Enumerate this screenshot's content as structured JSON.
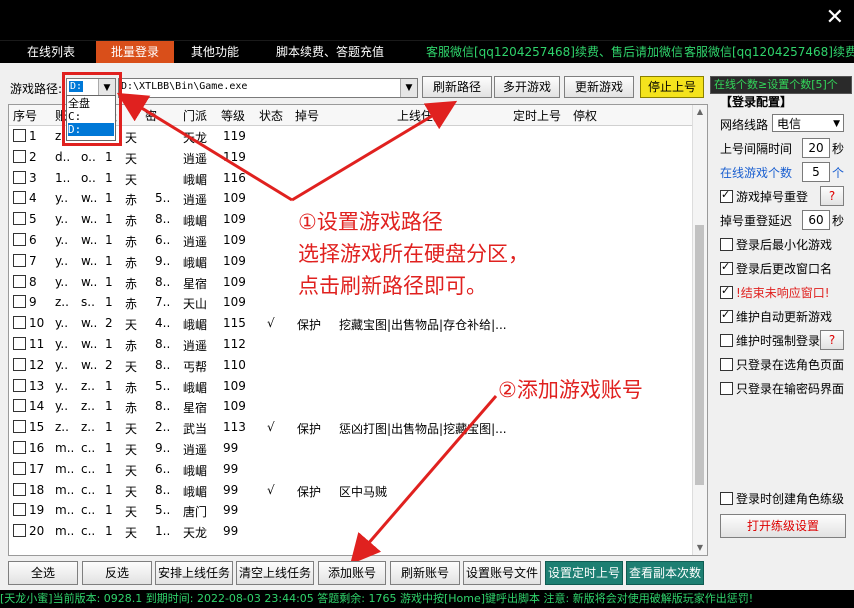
{
  "window": {
    "close_glyph": "✕"
  },
  "tabs": [
    {
      "label": "在线列表"
    },
    {
      "label": "批量登录"
    },
    {
      "label": "其他功能"
    },
    {
      "label": "脚本续费、答题充值"
    }
  ],
  "notices": [
    "客服微信[qq1204257468]续费、售后请加微信",
    "客服微信[qq1204257468]续费、售"
  ],
  "path": {
    "label": "游戏路径:",
    "drive_value": "D:",
    "exe_value": "D:\\XTLBB\\Bin\\Game.exe",
    "drive_options": [
      "全盘",
      "C:",
      "D:"
    ]
  },
  "toolbar": {
    "refresh_path": "刷新路径",
    "multi_open": "多开游戏",
    "update_game": "更新游戏",
    "stop_login": "停止上号"
  },
  "online_count_label": "在线个数≥设置个数[5]个",
  "grid": {
    "headers": [
      "序号",
      "账号",
      "服",
      "密",
      "门派",
      "等级",
      "状态",
      "掉号",
      "上线任务",
      "定时上号",
      "停权"
    ],
    "rows": [
      {
        "no": "1",
        "acc": "z..",
        "srv": "o..",
        "n": "1",
        "pw": "天",
        "pw2": "",
        "school": "天龙",
        "lvl": "119",
        "state": "",
        "drop": "",
        "task": ""
      },
      {
        "no": "2",
        "acc": "d..",
        "srv": "o..",
        "n": "1",
        "pw": "天",
        "pw2": "",
        "school": "逍遥",
        "lvl": "119",
        "state": "",
        "drop": "",
        "task": ""
      },
      {
        "no": "3",
        "acc": "1..",
        "srv": "o..",
        "n": "1",
        "pw": "天",
        "pw2": "",
        "school": "峨嵋",
        "lvl": "116",
        "state": "",
        "drop": "",
        "task": ""
      },
      {
        "no": "4",
        "acc": "y..",
        "srv": "w..",
        "n": "1",
        "pw": "赤",
        "pw2": "5..",
        "school": "逍遥",
        "lvl": "109",
        "state": "",
        "drop": "",
        "task": ""
      },
      {
        "no": "5",
        "acc": "y..",
        "srv": "w..",
        "n": "1",
        "pw": "赤",
        "pw2": "8..",
        "school": "峨嵋",
        "lvl": "109",
        "state": "",
        "drop": "",
        "task": ""
      },
      {
        "no": "6",
        "acc": "y..",
        "srv": "w..",
        "n": "1",
        "pw": "赤",
        "pw2": "6..",
        "school": "逍遥",
        "lvl": "109",
        "state": "",
        "drop": "",
        "task": ""
      },
      {
        "no": "7",
        "acc": "y..",
        "srv": "w..",
        "n": "1",
        "pw": "赤",
        "pw2": "9..",
        "school": "峨嵋",
        "lvl": "109",
        "state": "",
        "drop": "",
        "task": ""
      },
      {
        "no": "8",
        "acc": "y..",
        "srv": "w..",
        "n": "1",
        "pw": "赤",
        "pw2": "8..",
        "school": "星宿",
        "lvl": "109",
        "state": "",
        "drop": "",
        "task": ""
      },
      {
        "no": "9",
        "acc": "z..",
        "srv": "s..",
        "n": "1",
        "pw": "赤",
        "pw2": "7..",
        "school": "天山",
        "lvl": "109",
        "state": "",
        "drop": "",
        "task": ""
      },
      {
        "no": "10",
        "acc": "y..",
        "srv": "w..",
        "n": "2",
        "pw": "天",
        "pw2": "4..",
        "school": "峨嵋",
        "lvl": "115",
        "state": "√",
        "drop": "保护",
        "task": "挖藏宝图|出售物品|存仓补给|..."
      },
      {
        "no": "11",
        "acc": "y..",
        "srv": "w..",
        "n": "1",
        "pw": "赤",
        "pw2": "8..",
        "school": "逍遥",
        "lvl": "112",
        "state": "",
        "drop": "",
        "task": ""
      },
      {
        "no": "12",
        "acc": "y..",
        "srv": "w..",
        "n": "2",
        "pw": "天",
        "pw2": "8..",
        "school": "丐帮",
        "lvl": "110",
        "state": "",
        "drop": "",
        "task": ""
      },
      {
        "no": "13",
        "acc": "y..",
        "srv": "z..",
        "n": "1",
        "pw": "赤",
        "pw2": "5..",
        "school": "峨嵋",
        "lvl": "109",
        "state": "",
        "drop": "",
        "task": ""
      },
      {
        "no": "14",
        "acc": "y..",
        "srv": "z..",
        "n": "1",
        "pw": "赤",
        "pw2": "8..",
        "school": "星宿",
        "lvl": "109",
        "state": "",
        "drop": "",
        "task": ""
      },
      {
        "no": "15",
        "acc": "z..",
        "srv": "z..",
        "n": "1",
        "pw": "天",
        "pw2": "2..",
        "school": "武当",
        "lvl": "113",
        "state": "√",
        "drop": "保护",
        "task": "惩凶打图|出售物品|挖藏宝图|..."
      },
      {
        "no": "16",
        "acc": "m..",
        "srv": "c..",
        "n": "1",
        "pw": "天",
        "pw2": "9..",
        "school": "逍遥",
        "lvl": "99",
        "state": "",
        "drop": "",
        "task": ""
      },
      {
        "no": "17",
        "acc": "m..",
        "srv": "c..",
        "n": "1",
        "pw": "天",
        "pw2": "6..",
        "school": "峨嵋",
        "lvl": "99",
        "state": "",
        "drop": "",
        "task": ""
      },
      {
        "no": "18",
        "acc": "m..",
        "srv": "c..",
        "n": "1",
        "pw": "天",
        "pw2": "8..",
        "school": "峨嵋",
        "lvl": "99",
        "state": "√",
        "drop": "保护",
        "task": "区中马贼"
      },
      {
        "no": "19",
        "acc": "m..",
        "srv": "c..",
        "n": "1",
        "pw": "天",
        "pw2": "5..",
        "school": "唐门",
        "lvl": "99",
        "state": "",
        "drop": "",
        "task": ""
      },
      {
        "no": "20",
        "acc": "m..",
        "srv": "c..",
        "n": "1",
        "pw": "天",
        "pw2": "1..",
        "school": "天龙",
        "lvl": "99",
        "state": "",
        "drop": "",
        "task": ""
      }
    ]
  },
  "bottom_buttons": {
    "select_all": "全选",
    "invert": "反选",
    "arrange_tasks": "安排上线任务",
    "clear_tasks": "清空上线任务",
    "add_account": "添加账号",
    "refresh_account": "刷新账号",
    "set_account_file": "设置账号文件",
    "set_timed_login": "设置定时上号",
    "check_dungeon": "查看副本次数"
  },
  "annotations": {
    "a1_line1": "①设置游戏路径",
    "a1_line2": "选择游戏所在硬盘分区，",
    "a1_line3": "点击刷新路径即可。",
    "a2": "②添加游戏账号"
  },
  "config": {
    "title": "【登录配置】",
    "network_label": "网络线路",
    "network_value": "电信",
    "interval_label": "上号间隔时间",
    "interval_value": "20",
    "interval_unit": "秒",
    "online_label": "在线游戏个数",
    "online_value": "5",
    "online_unit": "个",
    "drop_relogin": "游戏掉号重登",
    "help_q": "?",
    "relogin_delay_label": "掉号重登延迟",
    "relogin_delay_value": "60",
    "relogin_delay_unit": "秒",
    "minimize": "登录后最小化游戏",
    "rename": "登录后更改窗口名",
    "kill_unresponsive": "!结束未响应窗口!",
    "auto_update": "维护自动更新游戏",
    "force_login": "维护时强制登录",
    "only_select_role": "只登录在选角色页面",
    "only_password": "只登录在输密码界面",
    "create_role": "登录时创建角色练级",
    "open_level_settings": "打开练级设置"
  },
  "status_bar": "[天龙小蜜]当前版本: 0928.1   到期时间: 2022-08-03 23:44:05   答题剩余: 1765   游戏中按[Home]键呼出脚本  注意: 新版将会对使用破解版玩家作出惩罚!"
}
